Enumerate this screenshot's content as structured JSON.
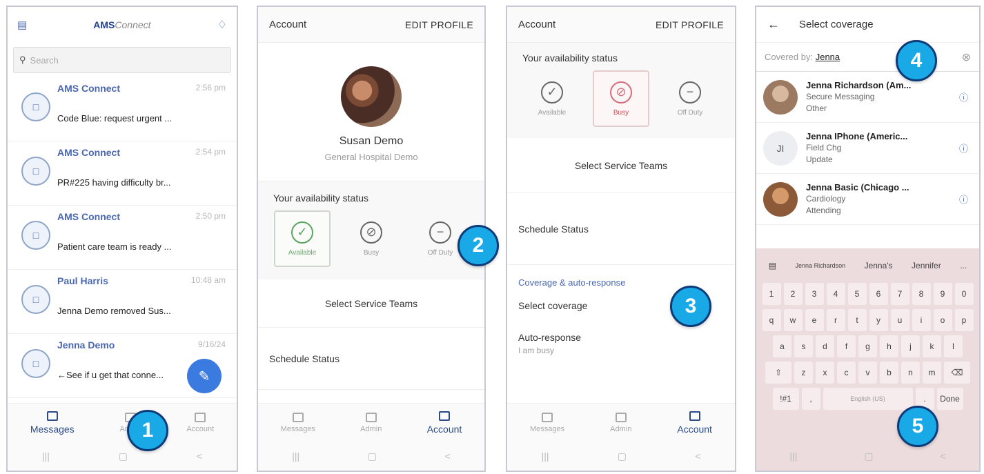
{
  "badges": [
    "1",
    "2",
    "3",
    "4",
    "5"
  ],
  "screen1": {
    "app_name": "AMS",
    "app_name_suffix": "Connect",
    "search_placeholder": "Search",
    "messages": [
      {
        "sender": "AMS Connect",
        "time": "2:56 pm",
        "preview": "Code Blue: request urgent ..."
      },
      {
        "sender": "AMS Connect",
        "time": "2:54 pm",
        "preview": "PR#225 having difficulty br..."
      },
      {
        "sender": "AMS Connect",
        "time": "2:50 pm",
        "preview": "Patient care team is ready ..."
      },
      {
        "sender": "Paul Harris",
        "time": "10:48 am",
        "preview": "Jenna Demo removed Sus..."
      },
      {
        "sender": "Jenna Demo",
        "time": "9/16/24",
        "preview": "←See if u get that conne..."
      }
    ],
    "tabs": {
      "messages": "Messages",
      "admin": "Admin",
      "account": "Account"
    }
  },
  "screen2": {
    "header": {
      "title": "Account",
      "action": "EDIT PROFILE"
    },
    "profile": {
      "name": "Susan Demo",
      "org": "General Hospital Demo"
    },
    "availability_title": "Your availability status",
    "statuses": {
      "available": "Available",
      "busy": "Busy",
      "off": "Off Duty"
    },
    "select_teams": "Select Service Teams",
    "schedule": "Schedule Status",
    "tabs": {
      "messages": "Messages",
      "admin": "Admin",
      "account": "Account"
    }
  },
  "screen3": {
    "header": {
      "title": "Account",
      "action": "EDIT PROFILE"
    },
    "availability_title": "Your availability status",
    "statuses": {
      "available": "Available",
      "busy": "Busy",
      "off": "Off Duty"
    },
    "select_teams": "Select Service Teams",
    "schedule": "Schedule Status",
    "coverage_section": "Coverage & auto-response",
    "select_coverage": "Select coverage",
    "auto_response": "Auto-response",
    "auto_response_value": "I am busy",
    "tabs": {
      "messages": "Messages",
      "admin": "Admin",
      "account": "Account"
    }
  },
  "screen4": {
    "header": {
      "title": "Select coverage"
    },
    "covered_label": "Covered by:",
    "covered_value": "Jenna",
    "contacts": [
      {
        "name": "Jenna Richardson (Am...",
        "line1": "Secure Messaging",
        "line2": "Other",
        "initials": ""
      },
      {
        "name": "Jenna IPhone (Americ...",
        "line1": "Field Chg",
        "line2": "Update",
        "initials": "JI"
      },
      {
        "name": "Jenna Basic (Chicago ...",
        "line1": "Cardiology",
        "line2": "Attending",
        "initials": ""
      }
    ],
    "suggestions": [
      "Jenna Richardson",
      "Jenna's",
      "Jennifer",
      "..."
    ],
    "keys_row1": [
      "1",
      "2",
      "3",
      "4",
      "5",
      "6",
      "7",
      "8",
      "9",
      "0"
    ],
    "keys_row2": [
      "q",
      "w",
      "e",
      "r",
      "t",
      "y",
      "u",
      "i",
      "o",
      "p"
    ],
    "keys_row3": [
      "a",
      "s",
      "d",
      "f",
      "g",
      "h",
      "j",
      "k",
      "l"
    ],
    "keys_row4": [
      "z",
      "x",
      "c",
      "v",
      "b",
      "n",
      "m"
    ],
    "sym_key": "!#1",
    "space_label": "English (US)",
    "done_key": "Done"
  },
  "nav": {
    "recent": "|||",
    "home": "▢",
    "back": "<"
  }
}
